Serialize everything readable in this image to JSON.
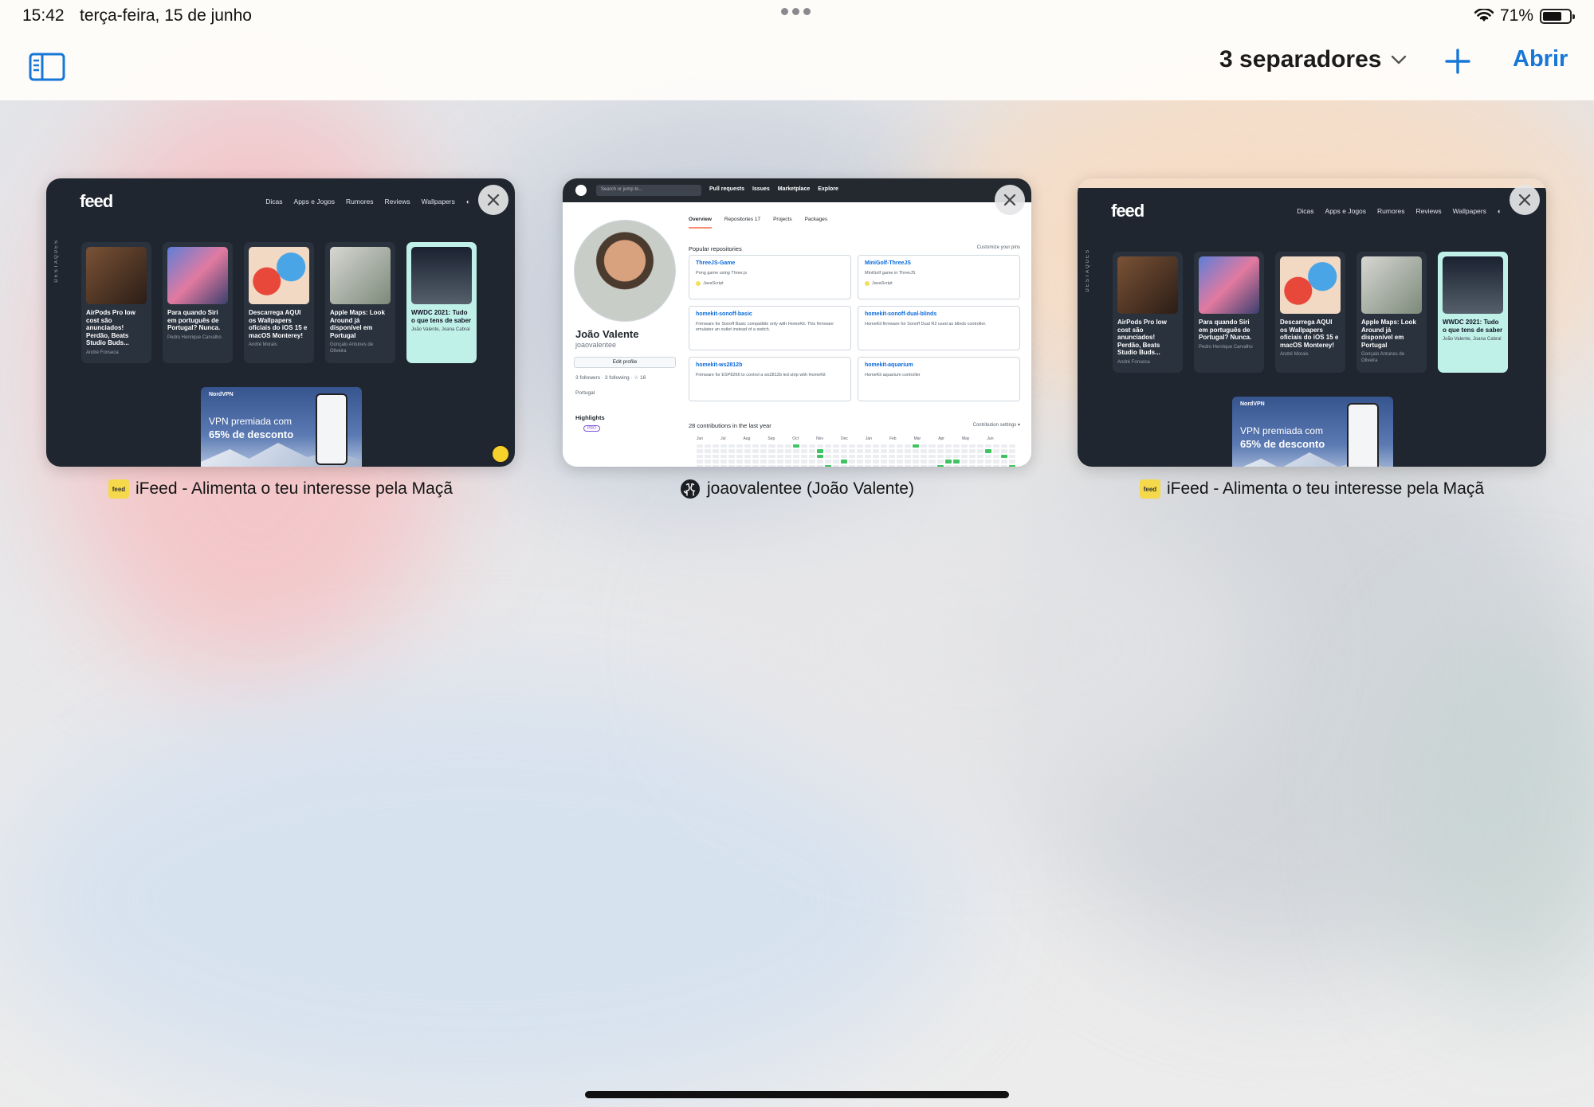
{
  "status_bar": {
    "time": "15:42",
    "date": "terça-feira, 15 de junho",
    "battery_text": "71%",
    "battery_level": 0.71
  },
  "toolbar": {
    "tabs_count_label": "3 separadores",
    "open_label": "Abrir",
    "accent_color": "#1677d8"
  },
  "tabs": [
    {
      "title": "iFeed - Alimenta o teu interesse pela Maçã",
      "favicon_text": "feed",
      "preview": {
        "logo": "feed",
        "nav": [
          "Dicas",
          "Apps e Jogos",
          "Rumores",
          "Reviews",
          "Wallpapers"
        ],
        "side_label": "DESTAQUES",
        "articles": [
          {
            "title": "AirPods Pro low cost são anunciados! Perdão, Beats Studio Buds...",
            "author": "André Fonseca"
          },
          {
            "title": "Para quando Siri em português de Portugal? Nunca.",
            "author": "Pedro Henrique Carvalho"
          },
          {
            "title": "Descarrega AQUI os Wallpapers oficiais do iOS 15 e macOS Monterey!",
            "author": "André Morais"
          },
          {
            "title": "Apple Maps: Look Around já disponível em Portugal",
            "author": "Gonçalo Antunes de Oliveira"
          },
          {
            "title": "WWDC 2021: Tudo o que tens de saber",
            "author": "João Valente, Joana Cabral"
          }
        ],
        "banner_brand": "NordVPN",
        "banner_line1": "VPN premiada com",
        "banner_line2": "65% de desconto"
      }
    },
    {
      "title": "joaovalentee (João Valente)",
      "favicon_text": "",
      "preview": {
        "search_placeholder": "Search or jump to...",
        "links": [
          "Pull requests",
          "Issues",
          "Marketplace",
          "Explore"
        ],
        "name": "João Valente",
        "login": "joaovalentee",
        "edit_profile": "Edit profile",
        "meta": "3 followers · 3 following · ☆ 16",
        "location": "Portugal",
        "highlights": "Highlights",
        "pro_badge": "PRO",
        "tabs": [
          "Overview",
          "Repositories 17",
          "Projects",
          "Packages"
        ],
        "popular": "Popular repositories",
        "customize": "Customize your pins",
        "repos": [
          {
            "name": "ThreeJS-Game",
            "desc": "Pong game using Three.js",
            "lang": "JavaScript"
          },
          {
            "name": "MiniGolf-ThreeJS",
            "desc": "MiniGolf game in ThreeJS",
            "lang": "JavaScript"
          },
          {
            "name": "homekit-sonoff-basic",
            "desc": "Firmware for Sonoff Basic compatible only with HomeKit. This firmware emulates an outlet instead of a switch.",
            "lang": ""
          },
          {
            "name": "homekit-sonoff-dual-blinds",
            "desc": "HomeKit firmware for Sonoff Dual R2 used as blinds controller.",
            "lang": ""
          },
          {
            "name": "homekit-ws2812b",
            "desc": "Firmware for ESP8266 to control a ws2812b led strip with HomeKit",
            "lang": ""
          },
          {
            "name": "homekit-aquarium",
            "desc": "HomeKit aquarium controller",
            "lang": ""
          }
        ],
        "contributions": "28 contributions in the last year",
        "contrib_settings": "Contribution settings ▾",
        "months": [
          "Jun",
          "Jul",
          "Aug",
          "Sep",
          "Oct",
          "Nov",
          "Dec",
          "Jan",
          "Feb",
          "Mar",
          "Apr",
          "May",
          "Jun"
        ]
      }
    },
    {
      "title": "iFeed - Alimenta o teu interesse pela Maçã",
      "favicon_text": "feed",
      "preview": {
        "logo": "feed",
        "nav": [
          "Dicas",
          "Apps e Jogos",
          "Rumores",
          "Reviews",
          "Wallpapers"
        ],
        "side_label": "DESTAQUES",
        "articles": [
          {
            "title": "AirPods Pro low cost são anunciados! Perdão, Beats Studio Buds...",
            "author": "André Fonseca"
          },
          {
            "title": "Para quando Siri em português de Portugal? Nunca.",
            "author": "Pedro Henrique Carvalho"
          },
          {
            "title": "Descarrega AQUI os Wallpapers oficiais do iOS 15 e macOS Monterey!",
            "author": "André Morais"
          },
          {
            "title": "Apple Maps: Look Around já disponível em Portugal",
            "author": "Gonçalo Antunes de Oliveira"
          },
          {
            "title": "WWDC 2021: Tudo o que tens de saber",
            "author": "João Valente, Joana Cabral"
          }
        ],
        "banner_brand": "NordVPN",
        "banner_line1": "VPN premiada com",
        "banner_line2": "65% de desconto"
      }
    }
  ]
}
